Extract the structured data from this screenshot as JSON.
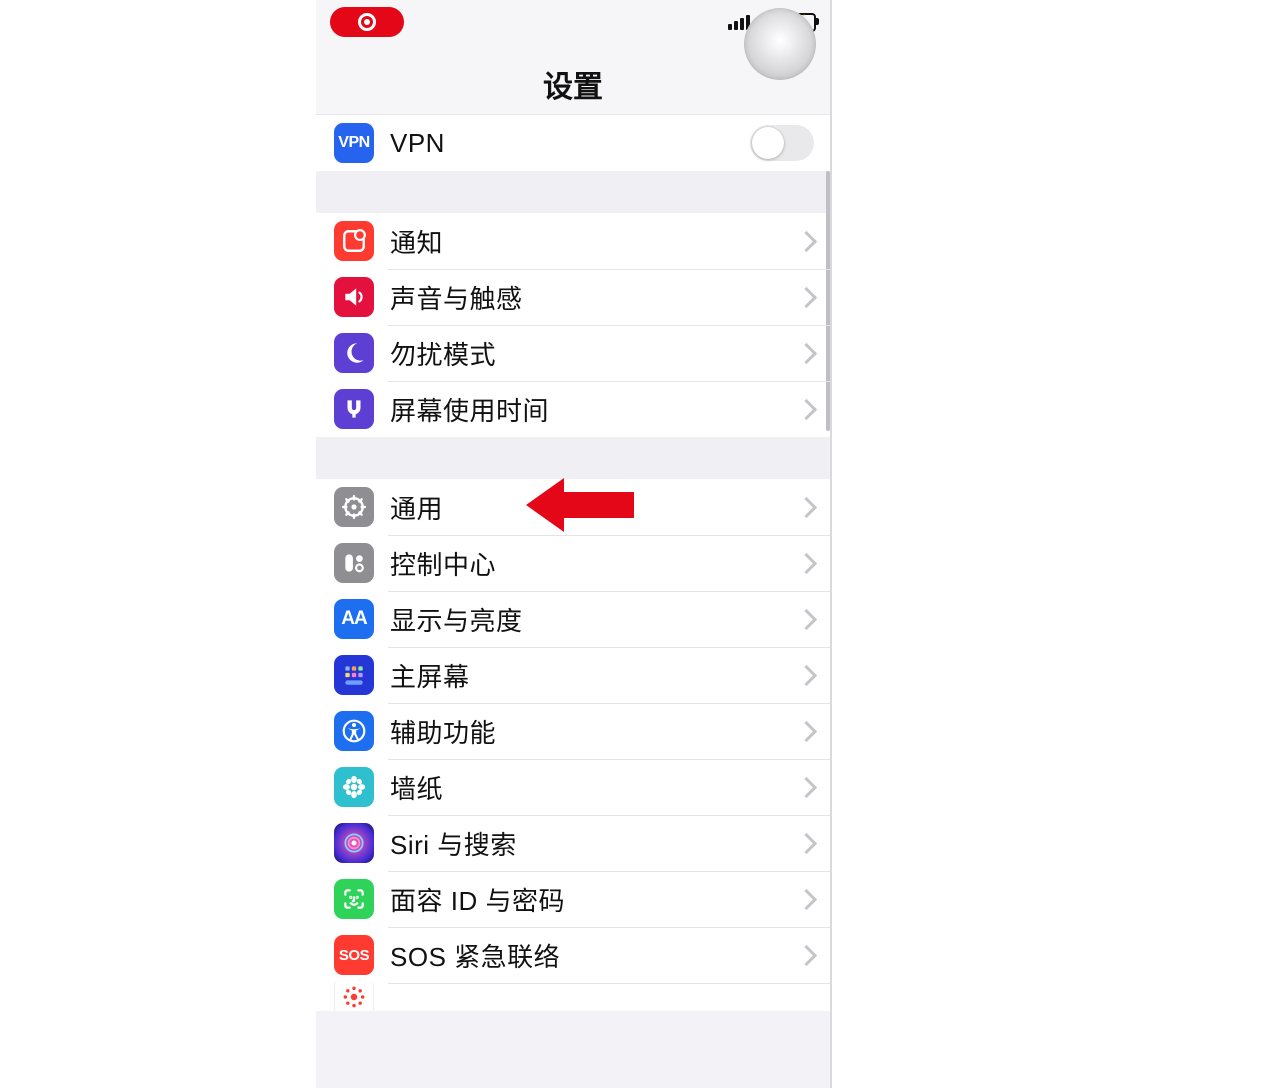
{
  "header": {
    "title": "设置"
  },
  "status": {
    "recording": true
  },
  "vpn": {
    "icon_label": "VPN",
    "label": "VPN",
    "on": false
  },
  "group_notifications": [
    {
      "key": "notifications",
      "label": "通知"
    },
    {
      "key": "sounds",
      "label": "声音与触感"
    },
    {
      "key": "dnd",
      "label": "勿扰模式"
    },
    {
      "key": "screen_time",
      "label": "屏幕使用时间"
    }
  ],
  "group_general": [
    {
      "key": "general",
      "label": "通用"
    },
    {
      "key": "control_center",
      "label": "控制中心"
    },
    {
      "key": "display",
      "label": "显示与亮度"
    },
    {
      "key": "home_screen",
      "label": "主屏幕"
    },
    {
      "key": "accessibility",
      "label": "辅助功能"
    },
    {
      "key": "wallpaper",
      "label": "墙纸"
    },
    {
      "key": "siri",
      "label": "Siri 与搜索"
    },
    {
      "key": "face_id",
      "label": "面容 ID 与密码"
    },
    {
      "key": "sos",
      "label": "SOS 紧急联络",
      "icon_label": "SOS"
    }
  ],
  "display_icon_text": "AA",
  "annotation": {
    "points_to": "general"
  }
}
